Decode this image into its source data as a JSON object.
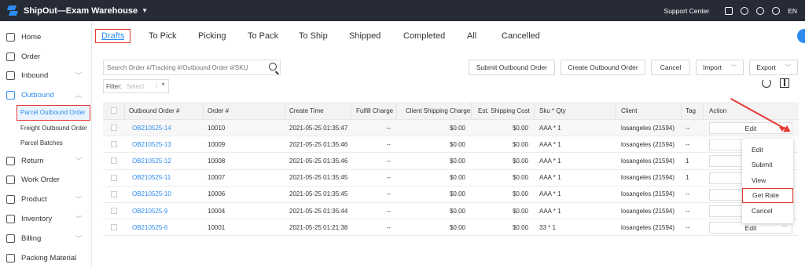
{
  "header": {
    "app_title": "ShipOut—Exam Warehouse",
    "support_label": "Support Center",
    "language": "EN",
    "icons": [
      "external-link-icon",
      "refresh-icon",
      "gear-icon",
      "user-icon"
    ]
  },
  "sidebar": {
    "items": [
      {
        "label": "Home",
        "icon": "home-icon"
      },
      {
        "label": "Order",
        "icon": "cart-icon"
      },
      {
        "label": "Inbound",
        "icon": "inbound-icon",
        "chevron": "chevron-down"
      },
      {
        "label": "Outbound",
        "icon": "outbound-icon",
        "chevron": "chevron-up",
        "active": true
      },
      {
        "label": "Return",
        "icon": "return-icon",
        "chevron": "chevron-down"
      },
      {
        "label": "Work Order",
        "icon": "work-order-icon"
      },
      {
        "label": "Product",
        "icon": "product-icon",
        "chevron": "chevron-down"
      },
      {
        "label": "Inventory",
        "icon": "inventory-icon",
        "chevron": "chevron-down"
      },
      {
        "label": "Billing",
        "icon": "billing-icon",
        "chevron": "chevron-down"
      },
      {
        "label": "Packing Material",
        "icon": "packing-icon"
      }
    ],
    "outbound_sub": [
      {
        "label": "Parcel Outbound Order",
        "active": true
      },
      {
        "label": "Freight Outbound Order"
      },
      {
        "label": "Parcel Batches"
      }
    ]
  },
  "tabs": [
    "Drafts",
    "To Pick",
    "Picking",
    "To Pack",
    "To Ship",
    "Shipped",
    "Completed",
    "All",
    "Cancelled"
  ],
  "search": {
    "placeholder": "Search Order #/Tracking #/Outbound Order #/SKU"
  },
  "filter": {
    "label": "Filter:",
    "placeholder": "Select"
  },
  "toolbar": {
    "submit_outbound": "Submit Outbound Order",
    "create_outbound": "Create Outbound Order",
    "cancel": "Cancel",
    "import": "Import",
    "export": "Export"
  },
  "table": {
    "columns": [
      "Outbound Order #",
      "Order #",
      "Create Time",
      "Fulfill Charge",
      "Client Shipping Charge",
      "Est. Shipping Cost",
      "Sku * Qty",
      "Client",
      "Tag",
      "Action"
    ],
    "rows": [
      {
        "outbound": "OB210525-14",
        "order": "10010",
        "time": "2021-05-25 01:35:47",
        "fulfill": "--",
        "client_ship": "$0.00",
        "est": "$0.00",
        "sku": "AAA * 1",
        "client": "losangeles (21594)",
        "tag": "--",
        "action": "Edit"
      },
      {
        "outbound": "OB210525-13",
        "order": "10009",
        "time": "2021-05-25 01:35:46",
        "fulfill": "--",
        "client_ship": "$0.00",
        "est": "$0.00",
        "sku": "AAA * 1",
        "client": "losangeles (21594)",
        "tag": "--",
        "action": "Edit"
      },
      {
        "outbound": "OB210525-12",
        "order": "10008",
        "time": "2021-05-25 01:35:46",
        "fulfill": "--",
        "client_ship": "$0.00",
        "est": "$0.00",
        "sku": "AAA * 1",
        "client": "losangeles (21594)",
        "tag": "1",
        "action": "Edit"
      },
      {
        "outbound": "OB210525-11",
        "order": "10007",
        "time": "2021-05-25 01:35:45",
        "fulfill": "--",
        "client_ship": "$0.00",
        "est": "$0.00",
        "sku": "AAA * 1",
        "client": "losangeles (21594)",
        "tag": "1",
        "action": "Edit"
      },
      {
        "outbound": "OB210525-10",
        "order": "10006",
        "time": "2021-05-25 01:35:45",
        "fulfill": "--",
        "client_ship": "$0.00",
        "est": "$0.00",
        "sku": "AAA * 1",
        "client": "losangeles (21594)",
        "tag": "--",
        "action": "Edit"
      },
      {
        "outbound": "OB210525-9",
        "order": "10004",
        "time": "2021-05-25 01:35:44",
        "fulfill": "--",
        "client_ship": "$0.00",
        "est": "$0.00",
        "sku": "AAA * 1",
        "client": "losangeles (21594)",
        "tag": "--",
        "action": "Edit"
      },
      {
        "outbound": "OB210525-6",
        "order": "10001",
        "time": "2021-05-25 01:21:38",
        "fulfill": "--",
        "client_ship": "$0.00",
        "est": "$0.00",
        "sku": "33 * 1",
        "client": "losangeles (21594)",
        "tag": "--",
        "action": "Edit"
      }
    ]
  },
  "action_menu": [
    "Edit",
    "Submit",
    "View",
    "Get Rate",
    "Cancel"
  ],
  "colors": {
    "accent": "#2d8cf0",
    "highlight": "#e53935",
    "topbar": "#262b36"
  }
}
